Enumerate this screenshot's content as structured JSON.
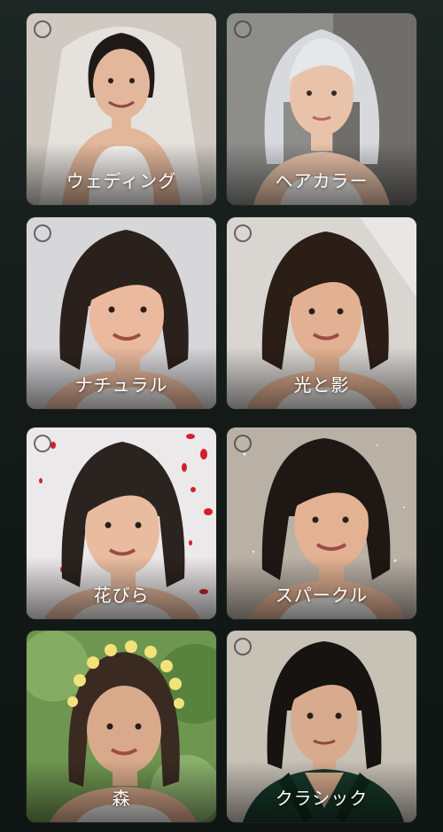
{
  "styles": [
    {
      "id": "wedding",
      "label": "ウェディング",
      "bg": "#c9c4bc",
      "hair": "#1f1a17",
      "skin": "#e2b79b",
      "outfit": "#f4f2ef"
    },
    {
      "id": "hair-color",
      "label": "ヘアカラー",
      "bg": "#8d8d8a",
      "hair": "#d8d9dc",
      "skin": "#e8c3aa",
      "outfit": "#f5f3f0"
    },
    {
      "id": "natural",
      "label": "ナチュラル",
      "bg": "#d7d6d8",
      "hair": "#2b211c",
      "skin": "#eab99e",
      "outfit": "#f1efec"
    },
    {
      "id": "light-shadow",
      "label": "光と影",
      "bg": "#d9d6d2",
      "hair": "#2a1e17",
      "skin": "#e2b193",
      "outfit": "#efeeec"
    },
    {
      "id": "petals",
      "label": "花びら",
      "bg": "#ece9ea",
      "hair": "#2b2320",
      "skin": "#e9bca0",
      "outfit": "#f0eeec"
    },
    {
      "id": "sparkle",
      "label": "スパークル",
      "bg": "#cfc9c1",
      "hair": "#1e1814",
      "skin": "#e3b293",
      "outfit": "#eeeeec"
    },
    {
      "id": "forest",
      "label": "森",
      "bg": "#6f9651",
      "hair": "#3a2a22",
      "skin": "#d9a98c",
      "outfit": "#ece9e4"
    },
    {
      "id": "classic",
      "label": "クラシック",
      "bg": "#c7c1b6",
      "hair": "#161311",
      "skin": "#d9ab8e",
      "outfit": "#17392a"
    }
  ]
}
